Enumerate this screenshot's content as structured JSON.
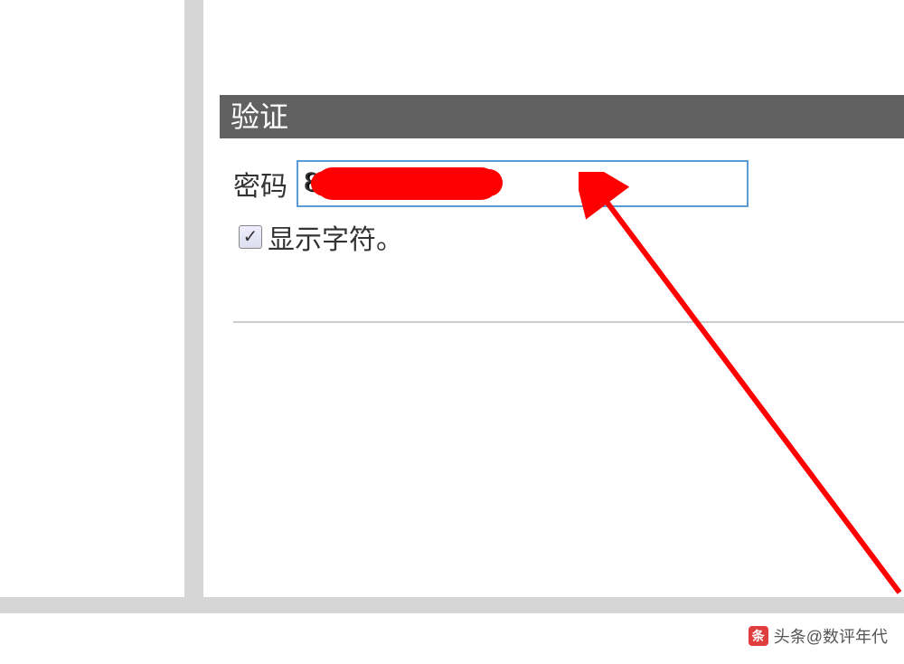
{
  "section": {
    "header": "验证"
  },
  "field": {
    "password_label": "密码",
    "password_value": "8"
  },
  "checkbox": {
    "show_chars_label": "显示字符。",
    "checked": true
  },
  "watermark": {
    "prefix": "头条",
    "author": "@数评年代"
  }
}
